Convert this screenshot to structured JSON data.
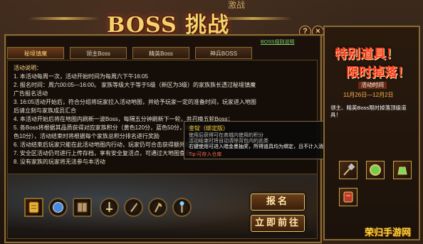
{
  "header": {
    "title": "BOSS 挑战",
    "banner_text": "激战",
    "help_button": "?",
    "close_button": "×"
  },
  "tabs": [
    {
      "label": "秘境镇魔",
      "active": true
    },
    {
      "label": "领主Boss",
      "active": false
    },
    {
      "label": "精英Boss",
      "active": false
    },
    {
      "label": "神兵BOSS",
      "active": false
    }
  ],
  "tab_link": "BOSS规则说明",
  "rules": {
    "lines": [
      "活动说明：",
      "1. 本活动每周一次，活动开始时间为每周六下午16:05",
      "2. 报名时间：周六00:05—16:00。 家族等级大于等于5级（新区为3级）的家族族长透过秘境镇魔",
      "广告报名活动",
      "3. 16:05活动开始后，符合分组将玩家拉入活动地图，并给予玩家一定的准备时间，玩家进入地图",
      "后请立刻与家族成员汇合",
      "4. 本活动开始后将在地图内刷新一波Boss，每隔五分钟刷新下一轮，共召唤五轮Boss；",
      "5. 各Boss将根据其品质获得对应家族积分（黄色120分，蓝色50分，绿色20分，紫",
      "色10分），活动结束时将根据每个家族总积分排名进行奖励",
      "6. 活动结束后玩家只能在此活动地图内行动，玩家仍可合击获得额外积分",
      "7. 安全区活动仍可进行上传存档，享有安全复活点，可通过大地图查看",
      "8. 没有家族的玩家将无法参与本活动"
    ]
  },
  "tooltip": {
    "title": "金锭（绑定版）",
    "line1": "使用后获得可在商城内使用的积分",
    "line2": "活动结束时将自动清除背包内的此类",
    "body": "右键使用可进入暗金墨抽奖，所得道具均为绑定，且不计入消耗榜",
    "foot": "Tip:可存入仓库"
  },
  "rewards": {
    "icons": [
      "gold-scroll-icon",
      "crystal-orb-icon",
      "spellbook-icon",
      "sword-emblem-icon",
      "blade-emblem-icon",
      "axe-emblem-icon",
      "staff-emblem-icon"
    ]
  },
  "buttons": {
    "signup": "报名",
    "go_now": "立即前往"
  },
  "side": {
    "heading1": "特别道具！",
    "heading2": "限时掉落！",
    "label": "活动时间",
    "date": "11月26日—12月2日",
    "description": "领主、精英Boss限时掉落顶级道具！",
    "icons": [
      "hammer-icon",
      "green-gem-icon",
      "jade-potion-icon",
      "red-scroll-icon"
    ]
  },
  "watermark": "荣归手游网",
  "colors": {
    "accent_gold": "#e9c56a",
    "heading_red": "#ff3b1f",
    "panel_bg": "#1b110a"
  }
}
